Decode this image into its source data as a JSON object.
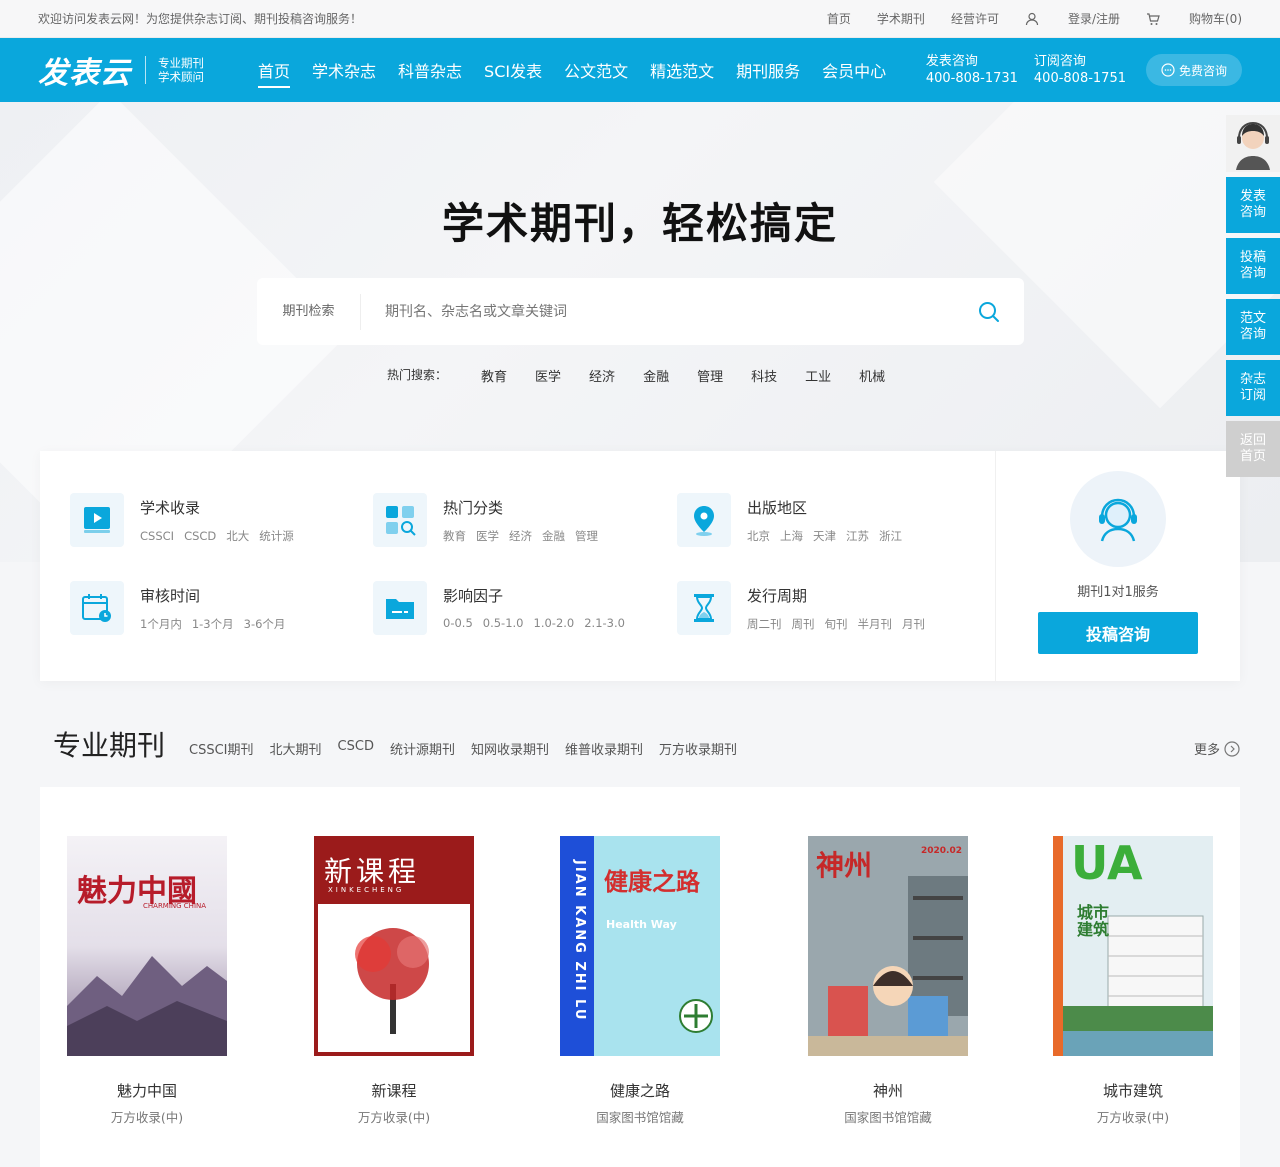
{
  "topbar": {
    "welcome": "欢迎访问发表云网！为您提供杂志订阅、期刊投稿咨询服务！",
    "links": [
      "首页",
      "学术期刊",
      "经营许可"
    ],
    "login": "登录/注册",
    "cart": "购物车(0)"
  },
  "header": {
    "brand": "发表云",
    "sub1": "专业期刊",
    "sub2": "学术顾问",
    "nav": [
      "首页",
      "学术杂志",
      "科普杂志",
      "SCI发表",
      "公文范文",
      "精选范文",
      "期刊服务",
      "会员中心"
    ],
    "contact1_label": "发表咨询",
    "contact1_phone": "400-808-1731",
    "contact2_label": "订阅咨询",
    "contact2_phone": "400-808-1751",
    "free_consult": "免费咨询"
  },
  "hero": {
    "title": "学术期刊，轻松搞定",
    "search_label": "期刊检索",
    "search_placeholder": "期刊名、杂志名或文章关键词",
    "hot_label": "热门搜索：",
    "hot_keywords": [
      "教育",
      "医学",
      "经济",
      "金融",
      "管理",
      "科技",
      "工业",
      "机械"
    ]
  },
  "categories": [
    {
      "title": "学术收录",
      "icon": "play-book-icon",
      "tags": [
        "CSSCI",
        "CSCD",
        "北大",
        "统计源"
      ]
    },
    {
      "title": "热门分类",
      "icon": "grid-search-icon",
      "tags": [
        "教育",
        "医学",
        "经济",
        "金融",
        "管理"
      ]
    },
    {
      "title": "出版地区",
      "icon": "location-pin-icon",
      "tags": [
        "北京",
        "上海",
        "天津",
        "江苏",
        "浙江"
      ]
    },
    {
      "title": "审核时间",
      "icon": "calendar-clock-icon",
      "tags": [
        "1个月内",
        "1-3个月",
        "3-6个月"
      ]
    },
    {
      "title": "影响因子",
      "icon": "folder-icon",
      "tags": [
        "0-0.5",
        "0.5-1.0",
        "1.0-2.0",
        "2.1-3.0"
      ]
    },
    {
      "title": "发行周期",
      "icon": "hourglass-icon",
      "tags": [
        "周二刊",
        "周刊",
        "旬刊",
        "半月刊",
        "月刊"
      ]
    }
  ],
  "service": {
    "text": "期刊1对1服务",
    "button": "投稿咨询"
  },
  "section": {
    "title": "专业期刊",
    "tabs": [
      "CSSCI期刊",
      "北大期刊",
      "CSCD",
      "统计源期刊",
      "知网收录期刊",
      "维普收录期刊",
      "万方收录期刊"
    ],
    "more": "更多"
  },
  "journals": [
    {
      "name": "魅力中国",
      "tag": "万方收录(中)",
      "cover_title": "魅力中國",
      "cover_sub": "CHARMING CHINA"
    },
    {
      "name": "新课程",
      "tag": "万方收录(中)",
      "cover_title": "新课程",
      "cover_sub": "XINKECHENG"
    },
    {
      "name": "健康之路",
      "tag": "国家图书馆馆藏",
      "cover_title": "健康之路",
      "cover_sub": "Health Way",
      "cover_spine": "JIAN KANG ZHI LU"
    },
    {
      "name": "神州",
      "tag": "国家图书馆馆藏",
      "cover_title": "神州",
      "cover_sub": "2020.02"
    },
    {
      "name": "城市建筑",
      "tag": "万方收录(中)",
      "cover_title": "城市建筑",
      "cover_sub": "UA"
    }
  ],
  "float": {
    "items": [
      "发表\n咨询",
      "投稿\n咨询",
      "范文\n咨询",
      "杂志\n订阅",
      "返回\n首页"
    ]
  },
  "colors": {
    "brand": "#0aa7dc",
    "nav_text": "#ffffff"
  }
}
